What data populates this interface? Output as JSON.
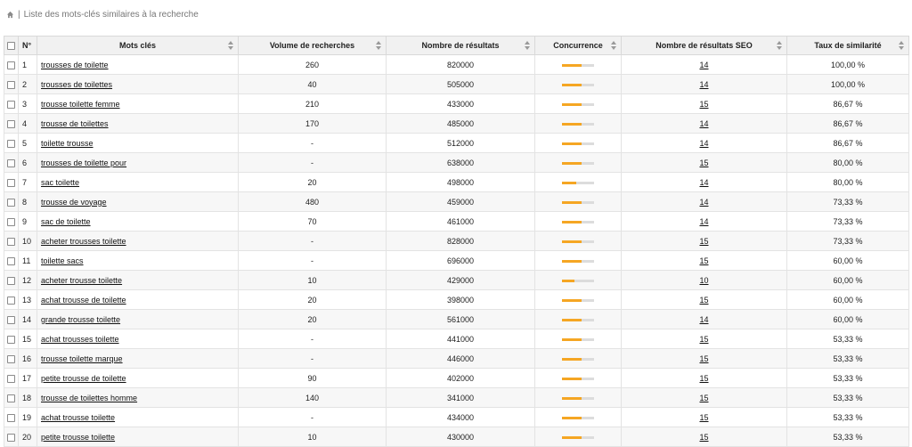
{
  "breadcrumb": {
    "separator": "|",
    "text": "Liste des mots-clés similaires à la recherche",
    "icon": "home-icon"
  },
  "colors": {
    "bar_fill": "#f5a623",
    "bar_track": "#dcdcdc",
    "header_bg": "#f1f1f1"
  },
  "table": {
    "headers": {
      "num": "N°",
      "keyword": "Mots clés",
      "volume": "Volume de recherches",
      "results": "Nombre de résultats",
      "competition": "Concurrence",
      "seo_results": "Nombre de résultats SEO",
      "similarity": "Taux de similarité"
    },
    "rows": [
      {
        "num": "1",
        "keyword": "trousses de toilette",
        "volume": "260",
        "results": "820000",
        "competition": 0.62,
        "seo": "14",
        "similarity": "100,00 %"
      },
      {
        "num": "2",
        "keyword": "trousses de toilettes",
        "volume": "40",
        "results": "505000",
        "competition": 0.62,
        "seo": "14",
        "similarity": "100,00 %"
      },
      {
        "num": "3",
        "keyword": "trousse toilette femme",
        "volume": "210",
        "results": "433000",
        "competition": 0.6,
        "seo": "15",
        "similarity": "86,67 %"
      },
      {
        "num": "4",
        "keyword": "trousse de toilettes",
        "volume": "170",
        "results": "485000",
        "competition": 0.6,
        "seo": "14",
        "similarity": "86,67 %"
      },
      {
        "num": "5",
        "keyword": "toilette trousse",
        "volume": "-",
        "results": "512000",
        "competition": 0.6,
        "seo": "14",
        "similarity": "86,67 %"
      },
      {
        "num": "6",
        "keyword": "trousses de toilette pour",
        "volume": "-",
        "results": "638000",
        "competition": 0.6,
        "seo": "15",
        "similarity": "80,00 %"
      },
      {
        "num": "7",
        "keyword": "sac toilette",
        "volume": "20",
        "results": "498000",
        "competition": 0.45,
        "seo": "14",
        "similarity": "80,00 %"
      },
      {
        "num": "8",
        "keyword": "trousse de voyage",
        "volume": "480",
        "results": "459000",
        "competition": 0.6,
        "seo": "14",
        "similarity": "73,33 %"
      },
      {
        "num": "9",
        "keyword": "sac de toilette",
        "volume": "70",
        "results": "461000",
        "competition": 0.6,
        "seo": "14",
        "similarity": "73,33 %"
      },
      {
        "num": "10",
        "keyword": "acheter trousses toilette",
        "volume": "-",
        "results": "828000",
        "competition": 0.62,
        "seo": "15",
        "similarity": "73,33 %"
      },
      {
        "num": "11",
        "keyword": "toilette sacs",
        "volume": "-",
        "results": "696000",
        "competition": 0.62,
        "seo": "15",
        "similarity": "60,00 %"
      },
      {
        "num": "12",
        "keyword": "acheter trousse toilette",
        "volume": "10",
        "results": "429000",
        "competition": 0.4,
        "seo": "10",
        "similarity": "60,00 %"
      },
      {
        "num": "13",
        "keyword": "achat trousse de toilette",
        "volume": "20",
        "results": "398000",
        "competition": 0.6,
        "seo": "15",
        "similarity": "60,00 %"
      },
      {
        "num": "14",
        "keyword": "grande trousse toilette",
        "volume": "20",
        "results": "561000",
        "competition": 0.6,
        "seo": "14",
        "similarity": "60,00 %"
      },
      {
        "num": "15",
        "keyword": "achat trousses toilette",
        "volume": "-",
        "results": "441000",
        "competition": 0.6,
        "seo": "15",
        "similarity": "53,33 %"
      },
      {
        "num": "16",
        "keyword": "trousse toilette marque",
        "volume": "-",
        "results": "446000",
        "competition": 0.6,
        "seo": "15",
        "similarity": "53,33 %"
      },
      {
        "num": "17",
        "keyword": "petite trousse de toilette",
        "volume": "90",
        "results": "402000",
        "competition": 0.6,
        "seo": "15",
        "similarity": "53,33 %"
      },
      {
        "num": "18",
        "keyword": "trousse de toilettes homme",
        "volume": "140",
        "results": "341000",
        "competition": 0.6,
        "seo": "15",
        "similarity": "53,33 %"
      },
      {
        "num": "19",
        "keyword": "achat trousse toilette",
        "volume": "-",
        "results": "434000",
        "competition": 0.6,
        "seo": "15",
        "similarity": "53,33 %"
      },
      {
        "num": "20",
        "keyword": "petite trousse toilette",
        "volume": "10",
        "results": "430000",
        "competition": 0.6,
        "seo": "15",
        "similarity": "53,33 %"
      }
    ]
  }
}
